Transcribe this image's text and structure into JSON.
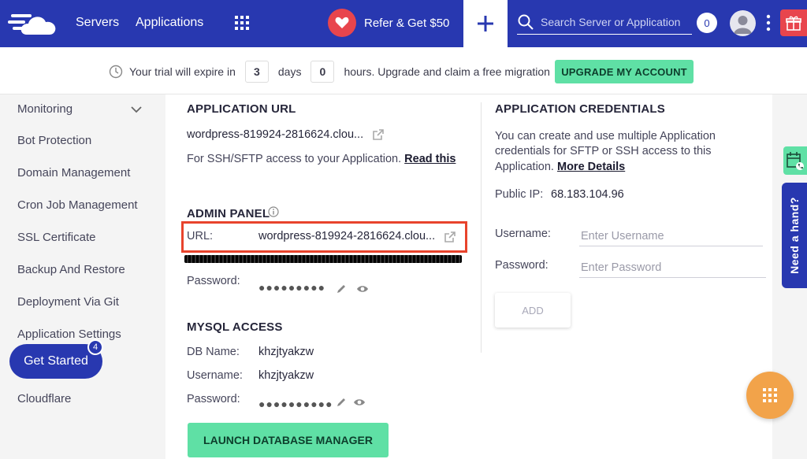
{
  "nav": {
    "servers": "Servers",
    "applications": "Applications",
    "refer": "Refer & Get $50",
    "search_placeholder": "Search Server or Application",
    "count": "0"
  },
  "trial": {
    "prefix": "Your trial will expire in",
    "days_value": "3",
    "days_label": "days",
    "hours_value": "0",
    "suffix": "hours. Upgrade and claim a free migration",
    "upgrade": "UPGRADE MY ACCOUNT"
  },
  "sidebar": {
    "items": [
      "Monitoring",
      "Bot Protection",
      "Domain Management",
      "Cron Job Management",
      "SSL Certificate",
      "Backup And Restore",
      "Deployment Via Git",
      "Application Settings",
      "Cloudflare"
    ],
    "get_started": "Get Started",
    "get_started_badge": "4"
  },
  "app_url": {
    "heading": "APPLICATION URL",
    "url": "wordpress-819924-2816624.clou...",
    "ssh_text": "For SSH/SFTP access to your Application.",
    "read_this": "Read this"
  },
  "admin_panel": {
    "heading": "ADMIN PANEL",
    "url_label": "URL:",
    "url": "wordpress-819924-2816624.clou...",
    "password_label": "Password:",
    "password_mask": "●●●●●●●●●"
  },
  "mysql": {
    "heading": "MYSQL ACCESS",
    "db_label": "DB Name:",
    "db_value": "khzjtyakzw",
    "user_label": "Username:",
    "user_value": "khzjtyakzw",
    "password_label": "Password:",
    "password_mask": "●●●●●●●●●●",
    "launch": "LAUNCH DATABASE MANAGER"
  },
  "credentials": {
    "heading": "APPLICATION CREDENTIALS",
    "desc_line1": "You can create and use multiple Application",
    "desc_line2": "credentials for SFTP or SSH access to this",
    "desc_line3": "Application.",
    "more_details": "More Details",
    "public_ip_label": "Public IP:",
    "public_ip": "68.183.104.96",
    "username_label": "Username:",
    "username_placeholder": "Enter Username",
    "password_label": "Password:",
    "password_placeholder": "Enter Password",
    "add": "ADD"
  },
  "widgets": {
    "need_hand": "Need a hand?"
  },
  "colors": {
    "brand": "#2838b0",
    "accent_green": "#5fe0a5",
    "highlight_red": "#e8432c",
    "fab_orange": "#f2a34a"
  }
}
